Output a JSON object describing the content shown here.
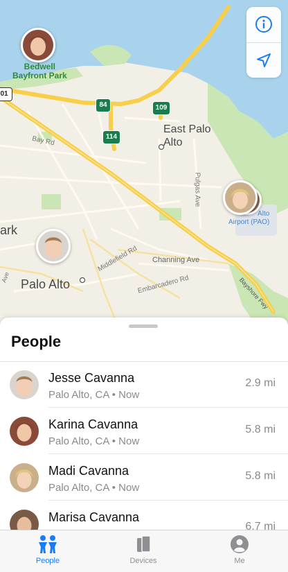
{
  "map": {
    "labels": {
      "bedwell_line1": "Bedwell",
      "bedwell_line2": "Bayfront Park",
      "east_palo_alto_line1": "East Palo",
      "east_palo_alto_line2": "Alto",
      "palo_alto": "Palo Alto",
      "park_fragment": "ark",
      "bay_rd": "Bay Rd",
      "pulgas_ave": "Pulgas Ave",
      "channing_ave": "Channing Ave",
      "middlefield_rd": "Middlefield Rd",
      "embarcadero_rd": "Embarcadero Rd",
      "bayshore_fwy": "Bayshore Fwy",
      "ave_fragment": "Ave",
      "airport_line1": "Alto",
      "airport_line2": "Airport (PAO)"
    },
    "shields": {
      "hw84": "84",
      "hw109": "109",
      "hw114": "114",
      "hw101": "01"
    },
    "controls": {
      "info_icon": "info-icon",
      "location_icon": "location-arrow-icon"
    }
  },
  "sheet": {
    "title": "People",
    "people": [
      {
        "name": "Jesse Cavanna",
        "location": "Palo Alto, CA • Now",
        "distance": "2.9 mi"
      },
      {
        "name": "Karina Cavanna",
        "location": "Palo Alto, CA • Now",
        "distance": "5.8 mi"
      },
      {
        "name": "Madi Cavanna",
        "location": "Palo Alto, CA • Now",
        "distance": "5.8 mi"
      },
      {
        "name": "Marisa Cavanna",
        "location": "",
        "distance": "6.7 mi"
      }
    ]
  },
  "tabbar": {
    "tabs": [
      {
        "label": "People",
        "icon": "people-icon",
        "active": true
      },
      {
        "label": "Devices",
        "icon": "devices-icon",
        "active": false
      },
      {
        "label": "Me",
        "icon": "me-icon",
        "active": false
      }
    ]
  },
  "colors": {
    "accent": "#1a7cf5",
    "water": "#a9d3ed",
    "land": "#f2efe6",
    "park": "#c9e6b4",
    "highway": "#f7cf4a"
  }
}
